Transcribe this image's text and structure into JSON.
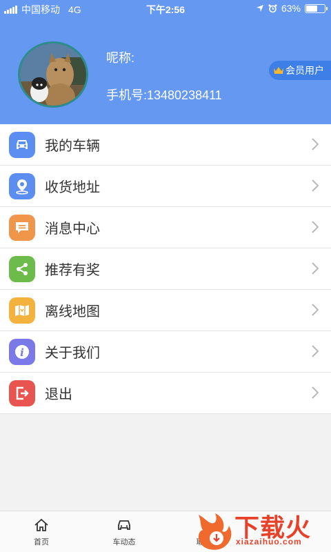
{
  "status_bar": {
    "carrier": "中国移动",
    "network": "4G",
    "time": "下午2:56",
    "battery_percent": "63%",
    "battery_level": 0.63
  },
  "profile": {
    "nickname_label": "呢称:",
    "phone_label": "手机号:13480238411",
    "vip_label": "会员用户"
  },
  "menu": {
    "items": [
      {
        "label": "我的车辆",
        "icon": "car-icon",
        "color": "#5b8ef0"
      },
      {
        "label": "收货地址",
        "icon": "location-pin-icon",
        "color": "#5b8ef0"
      },
      {
        "label": "消息中心",
        "icon": "message-icon",
        "color": "#f0964a"
      },
      {
        "label": "推荐有奖",
        "icon": "share-icon",
        "color": "#6dbb4a"
      },
      {
        "label": "离线地图",
        "icon": "map-icon",
        "color": "#f3b13e"
      },
      {
        "label": "关于我们",
        "icon": "info-icon",
        "color": "#7b78e8"
      },
      {
        "label": "退出",
        "icon": "logout-icon",
        "color": "#e85450"
      }
    ]
  },
  "tabbar": {
    "tabs": [
      {
        "label": "首页",
        "icon": "home-icon"
      },
      {
        "label": "车动态",
        "icon": "car-icon"
      },
      {
        "label": "耶",
        "icon": "unknown-icon"
      }
    ]
  },
  "watermark": {
    "brand": "下载火",
    "domain": "xiazaihuo.com"
  }
}
